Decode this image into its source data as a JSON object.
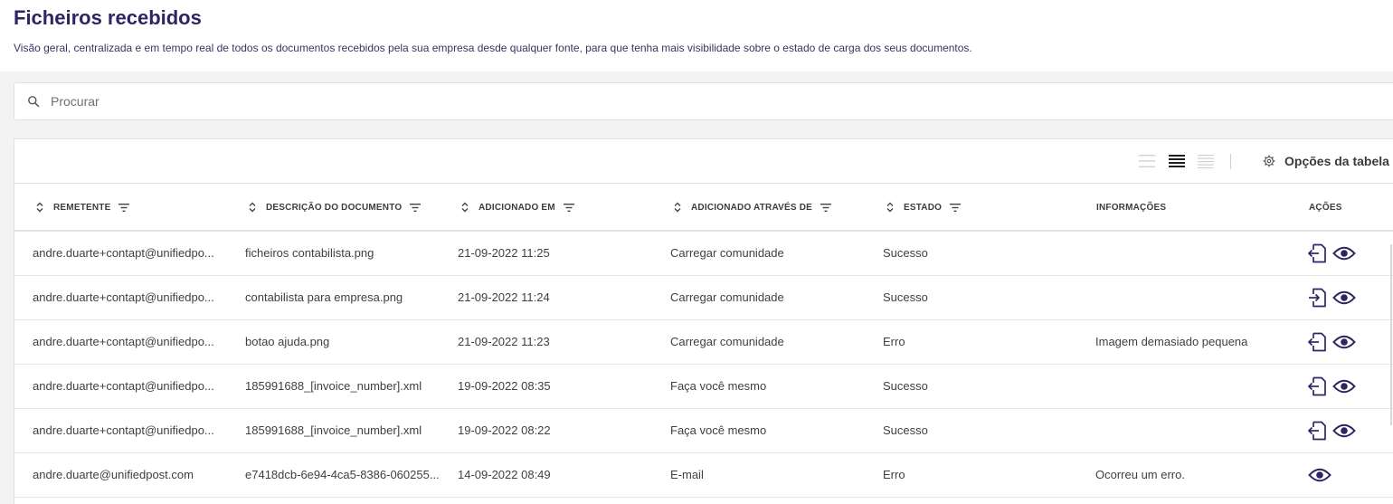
{
  "page": {
    "title": "Ficheiros recebidos",
    "subtitle": "Visão geral, centralizada e em tempo real de todos os documentos recebidos pela sua empresa desde qualquer fonte, para que tenha mais visibilidade sobre o estado de carga dos seus documentos."
  },
  "search": {
    "placeholder": "Procurar",
    "value": "",
    "icon": "search-icon"
  },
  "toolbar": {
    "density_options": [
      "compact-density-icon",
      "standard-density-icon",
      "comfortable-density-icon"
    ],
    "selected_density": "standard-density-icon",
    "options_label": "Opções da tabela",
    "options_icon": "gear-icon"
  },
  "table": {
    "columns": [
      {
        "label": "REMETENTE",
        "sortable": true,
        "filterable": true
      },
      {
        "label": "DESCRIÇÃO DO DOCUMENTO",
        "sortable": true,
        "filterable": true
      },
      {
        "label": "ADICIONADO EM",
        "sortable": true,
        "filterable": true
      },
      {
        "label": "ADICIONADO ATRAVÉS DE",
        "sortable": true,
        "filterable": true
      },
      {
        "label": "ESTADO",
        "sortable": true,
        "filterable": true
      },
      {
        "label": "INFORMAÇÕES",
        "sortable": false,
        "filterable": false
      },
      {
        "label": "AÇÕES",
        "sortable": false,
        "filterable": false
      }
    ],
    "rows": [
      {
        "sender": "andre.duarte+contapt@unifiedpo...",
        "description": "ficheiros contabilista.png",
        "added": "21-09-2022 11:25",
        "via": "Carregar comunidade",
        "status": "Sucesso",
        "info": "",
        "actions": [
          "export-document-icon",
          "view-icon"
        ]
      },
      {
        "sender": "andre.duarte+contapt@unifiedpo...",
        "description": "contabilista para empresa.png",
        "added": "21-09-2022 11:24",
        "via": "Carregar comunidade",
        "status": "Sucesso",
        "info": "",
        "actions": [
          "import-document-icon",
          "view-icon"
        ]
      },
      {
        "sender": "andre.duarte+contapt@unifiedpo...",
        "description": "botao ajuda.png",
        "added": "21-09-2022 11:23",
        "via": "Carregar comunidade",
        "status": "Erro",
        "info": "Imagem demasiado pequena",
        "actions": [
          "export-document-icon",
          "view-icon"
        ]
      },
      {
        "sender": "andre.duarte+contapt@unifiedpo...",
        "description": "185991688_[invoice_number].xml",
        "added": "19-09-2022 08:35",
        "via": "Faça você mesmo",
        "status": "Sucesso",
        "info": "",
        "actions": [
          "export-document-icon",
          "view-icon"
        ]
      },
      {
        "sender": "andre.duarte+contapt@unifiedpo...",
        "description": "185991688_[invoice_number].xml",
        "added": "19-09-2022 08:22",
        "via": "Faça você mesmo",
        "status": "Sucesso",
        "info": "",
        "actions": [
          "export-document-icon",
          "view-icon"
        ]
      },
      {
        "sender": "andre.duarte@unifiedpost.com",
        "description": "e7418dcb-6e94-4ca5-8386-060255...",
        "added": "14-09-2022 08:49",
        "via": "E-mail",
        "status": "Erro",
        "info": "Ocorreu um erro.",
        "actions": [
          "view-icon"
        ]
      }
    ]
  },
  "colors": {
    "brand": "#2d2563",
    "page_bg": "#f3f3f3",
    "border": "#e3e3e3",
    "text": "#404040"
  }
}
